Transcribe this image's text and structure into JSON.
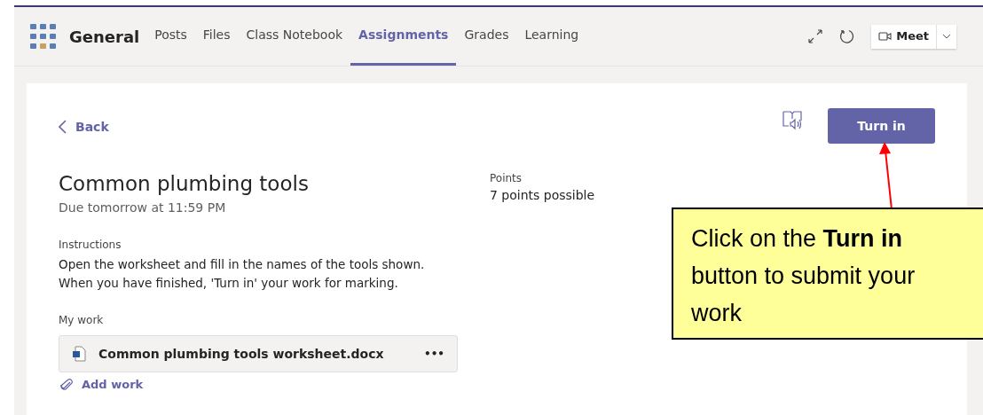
{
  "header": {
    "title": "General",
    "tabs": [
      {
        "label": "Posts",
        "selected": false
      },
      {
        "label": "Files",
        "selected": false
      },
      {
        "label": "Class Notebook",
        "selected": false
      },
      {
        "label": "Assignments",
        "selected": true
      },
      {
        "label": "Grades",
        "selected": false
      },
      {
        "label": "Learning",
        "selected": false
      }
    ],
    "meet": "Meet"
  },
  "back": "Back",
  "turn_in": "Turn in",
  "assignment": {
    "title": "Common plumbing tools",
    "due": "Due tomorrow at 11:59 PM",
    "points_label": "Points",
    "points": "7 points possible",
    "instructions_label": "Instructions",
    "instructions": "Open the worksheet and fill in the names of the tools shown.\nWhen you have finished, 'Turn in' your work for marking.",
    "my_work_label": "My work",
    "file": "Common plumbing tools worksheet.docx",
    "more": "•••",
    "add_work": "Add work"
  },
  "callout": {
    "text": "Click on the **Turn in** button to submit your work"
  }
}
